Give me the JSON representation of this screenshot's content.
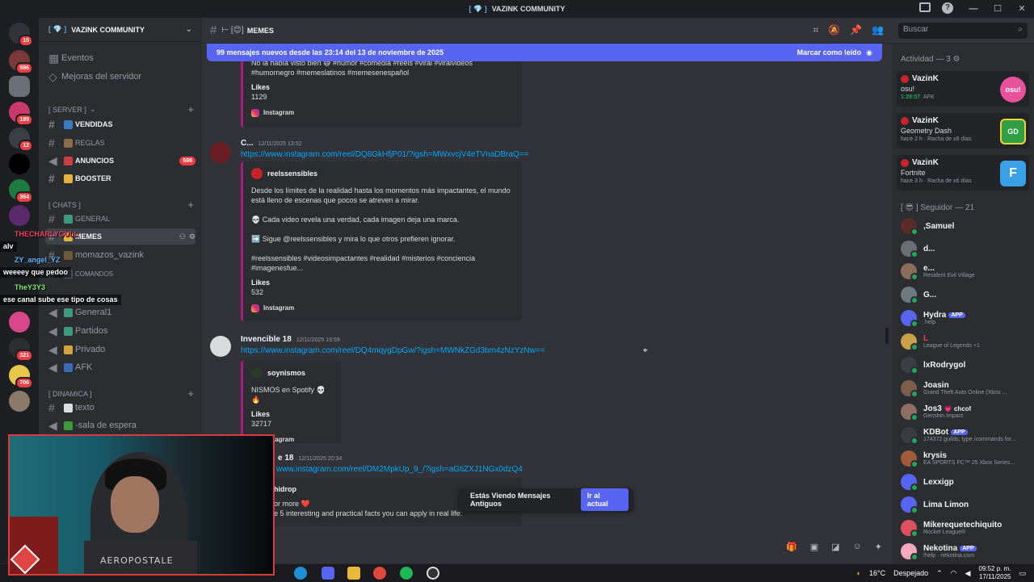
{
  "window": {
    "title": "VAZINK COMMUNITY"
  },
  "guilds": {
    "badges": [
      "15",
      "586",
      "189",
      "12",
      "364",
      "321",
      "706"
    ]
  },
  "server": {
    "name": "VAZINK COMMUNITY",
    "top_items": [
      "Eventos",
      "Mejoras del servidor"
    ],
    "categories": {
      "server": "[ SERVER ]",
      "chats": "[ CHATS ]",
      "dinamica": "[ DINAMICA ]"
    },
    "channels": {
      "ventas": "VENDIDAS",
      "reglas": "REGLAS",
      "anuncios": "ANUNCIOS",
      "anuncios_badge": "586",
      "booster": "BOOSTER",
      "general": "GENERAL",
      "memes": "MEMES",
      "momazos": "momazos_vazink",
      "comandos": "COMANDOS",
      "general_voice": "General1",
      "partidos": "Partidos",
      "privado": "Privado",
      "afk": "AFK",
      "texto": "texto",
      "sala": "-sala de espera"
    }
  },
  "overlay_chat": [
    {
      "name": "THECHARLYGULL",
      "msg": "alv"
    },
    {
      "name": "ZY_angel_YZ",
      "msg": "weeeey que pedoo"
    },
    {
      "name": "TheY3Y3",
      "msg": "ese canal sube ese tipo de cosas"
    }
  ],
  "webcam": {
    "shirt_text": "AEROPOSTALE"
  },
  "channel_header": {
    "name": "MEMES"
  },
  "search": {
    "placeholder": "Buscar"
  },
  "banner": {
    "text": "99 mensajes nuevos desde las 23:14 del 13 de noviembre de 2025",
    "action": "Marcar como leído"
  },
  "messages": [
    {
      "embed_top_lines": [
        "No la había visto bien 😅 #humor #comedia #reels #viral #viralvideos",
        "#humornegro #memeslatinos #memesenespañol"
      ],
      "likes_label": "Likes",
      "likes": "1129",
      "footer": "Instagram"
    },
    {
      "user": "C...",
      "time": "12/11/2025 13:52",
      "link": "https://www.instagram.com/reel/DQ8GkHfjP01/?igsh=MWxvcjV4eTVnaDBraQ==",
      "author": "reelssensibles",
      "paragraphs": [
        "Desde los límites de la realidad hasta los momentos más impactantes, el mundo está lleno de escenas que pocos se atreven a mirar.",
        "💀 Cada video revela una verdad, cada imagen deja una marca.",
        "➡️ Sigue @reelssensibles y mira lo que otros prefieren ignorar.",
        "#reelssensibles #videosimpactantes #realidad #misterios #conciencia #imagenesfue..."
      ],
      "likes_label": "Likes",
      "likes": "532",
      "footer": "Instagram"
    },
    {
      "user": "Invencible 18",
      "time": "12/11/2025 19:59",
      "link": "https://www.instagram.com/reel/DQ4mqygDpGw/?igsh=MWNkZGd3bm4zNzYzNw==",
      "author": "soynismos",
      "desc": "NISMOS en Spotify 💀🔥",
      "likes_label": "Likes",
      "likes": "32717",
      "footer": "Instagram"
    },
    {
      "user": "e 18",
      "time": "12/11/2025 20:34",
      "link": "www.instagram.com/reel/DM2MpkUp_9_/?igsh=aGtiZXJ1NGx0dzQ4",
      "author": "hidrop",
      "line1": "or more ❤️",
      "line2": "e 5 interesting and practical facts you can apply in real life:"
    }
  ],
  "old_messages_bar": {
    "text": "Estás Viendo Mensajes Antiguos",
    "button": "Ir al actual"
  },
  "members": {
    "activity_header": "Actividad — 3",
    "activities": [
      {
        "name": "VazinK",
        "game": "osu!",
        "status": "1:29:07",
        "extra": "AFK",
        "art": "osu!",
        "color": "#e8529a"
      },
      {
        "name": "VazinK",
        "game": "Geometry Dash",
        "status": "hace 2 h",
        "extra": "Racha de x8 días",
        "art": "GD",
        "color": "#2f9e44"
      },
      {
        "name": "VazinK",
        "game": "Fortnite",
        "status": "hace 3 h",
        "extra": "Racha de x6 días",
        "art": "F",
        "color": "#3aa0e8"
      }
    ],
    "section_header": "[ 😎 ] Seguidor — 21",
    "list": [
      {
        "name": ",Samuel",
        "sub": "",
        "color": "#5a2b2b"
      },
      {
        "name": "d...",
        "sub": "",
        "color": "#6b6f75"
      },
      {
        "name": "e...",
        "sub": "Resident Evil Village",
        "color": "#8a6d5a"
      },
      {
        "name": "G...",
        "sub": "",
        "color": "#6f7a80"
      },
      {
        "name": "Hydra",
        "sub": ".help",
        "color": "#5865f2",
        "badge": "APP"
      },
      {
        "name": "",
        "sub": "League of Legends +1",
        "color": "#c8a14a"
      },
      {
        "name": "lxRodrygol",
        "sub": "",
        "color": "#3b3f45"
      },
      {
        "name": "Joasin",
        "sub": "Grand Theft Auto Online (Xbox ...",
        "color": "#7d5e4d"
      },
      {
        "name": "Jos3",
        "sub": "Genshin Impact",
        "color": "#8e6f63",
        "tag": "💗 chcof"
      },
      {
        "name": "KDBot",
        "sub": "174372 guilds; type /commands for...",
        "color": "#3a3c42",
        "badge": "APP"
      },
      {
        "name": "krysis",
        "sub": "EA SPORTS FC™ 25 Xbox Series...",
        "color": "#a15a3a"
      },
      {
        "name": "Lexxigp",
        "sub": "",
        "color": "#5865f2"
      },
      {
        "name": "Lima Limon",
        "sub": "",
        "color": "#5865f2"
      },
      {
        "name": "Mikerequetechiquito",
        "sub": "Rocket League®",
        "color": "#e04f5f"
      },
      {
        "name": "Nekotina",
        "sub": "!help · nekotina.com",
        "color": "#f4a9c0",
        "badge": "APP"
      }
    ]
  },
  "taskbar": {
    "weather": "16°C",
    "weather_desc": "Despejado",
    "time": "09:52 p. m.",
    "date": "17/11/2025"
  },
  "colors": {
    "accent": "#5865f2",
    "embed_border": "#a91b7f",
    "link": "#00a8fc",
    "online": "#23a55a",
    "badge": "#f23f43"
  }
}
